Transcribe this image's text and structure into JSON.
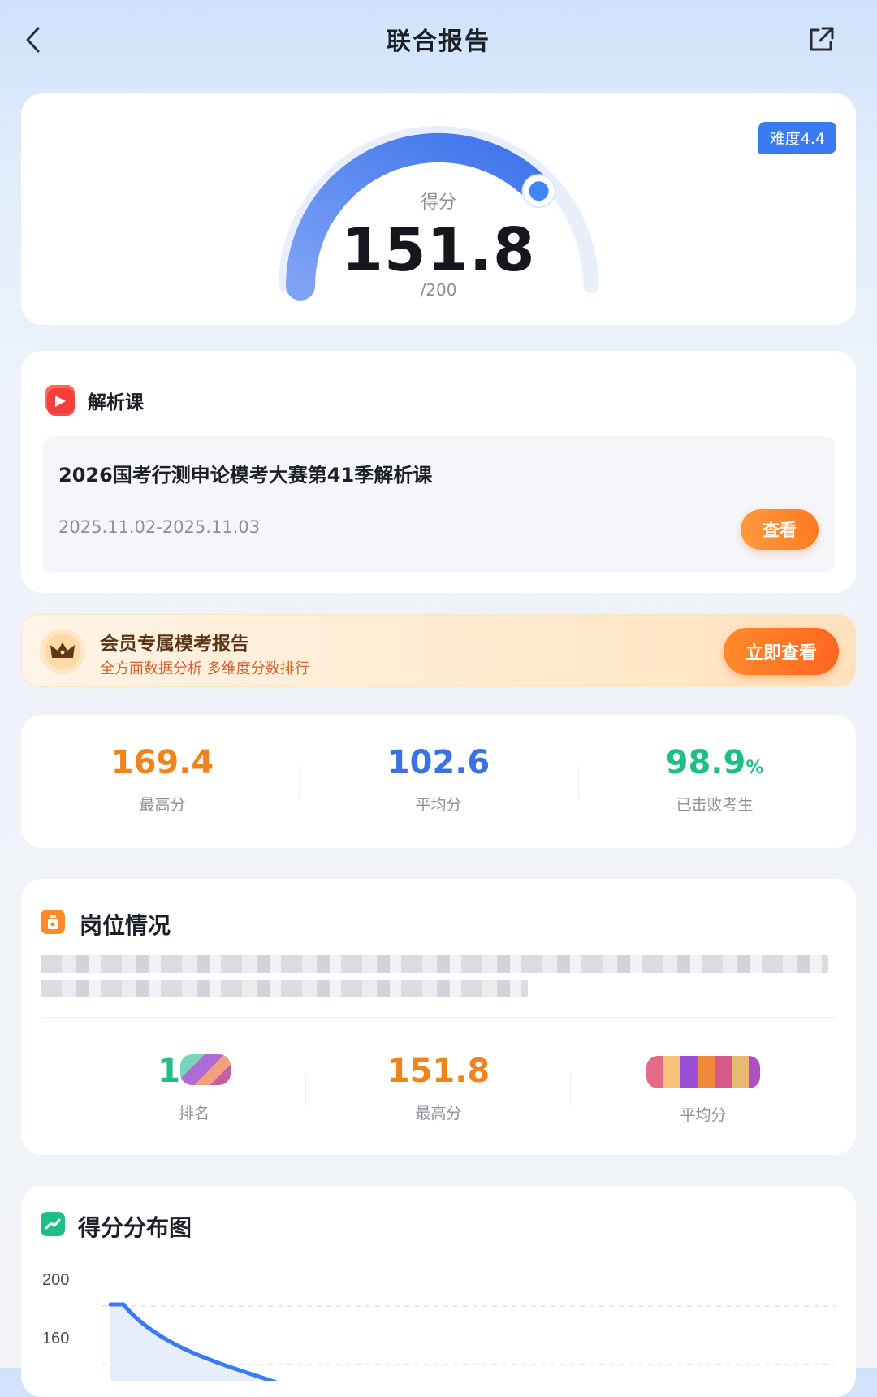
{
  "header": {
    "title": "联合报告"
  },
  "score_card": {
    "difficulty_badge": "难度4.4",
    "score_label": "得分",
    "score": "151.8",
    "total": "/200",
    "score_fraction": 0.759
  },
  "course": {
    "section_title": "解析课",
    "name": "2026国考行测申论模考大赛第41季解析课",
    "date_range": "2025.11.02-2025.11.03",
    "view_button": "查看"
  },
  "vip_banner": {
    "title": "会员专属模考报告",
    "subtitle": "全方面数据分析 多维度分数排行",
    "button": "立即查看"
  },
  "stats": [
    {
      "value": "169.4",
      "unit": "",
      "label": "最高分",
      "color": "#f0841c"
    },
    {
      "value": "102.6",
      "unit": "",
      "label": "平均分",
      "color": "#3a72e0"
    },
    {
      "value": "98.9",
      "unit": "%",
      "label": "已击败考生",
      "color": "#1dbf86"
    }
  ],
  "position": {
    "section_title": "岗位情况",
    "rank_label": "排名",
    "rank_visible_digit": "1",
    "max_value": "151.8",
    "max_label": "最高分",
    "avg_label": "平均分"
  },
  "distribution": {
    "section_title": "得分分布图"
  },
  "chart_data": {
    "type": "area",
    "y_ticks": [
      "200",
      "160"
    ],
    "colors": {
      "line": "#3a7bf2",
      "fill": "#e6eefc"
    }
  },
  "colors": {
    "accent_blue": "#3a7bf2",
    "accent_orange": "#ff7a22",
    "accent_green": "#1dbf86"
  }
}
